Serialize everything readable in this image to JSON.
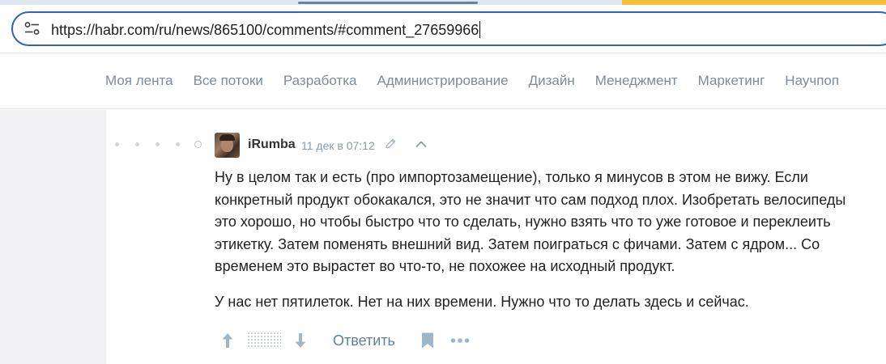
{
  "browser": {
    "url": "https://habr.com/ru/news/865100/comments/#comment_27659966",
    "colors": {
      "accent": "#2e65b8",
      "tab_highlight": "#f5bf3a"
    }
  },
  "nav": {
    "items": [
      "Моя лента",
      "Все потоки",
      "Разработка",
      "Администрирование",
      "Дизайн",
      "Менеджмент",
      "Маркетинг",
      "Научпоп"
    ]
  },
  "comment": {
    "author": "iRumba",
    "timestamp": "11 дек в 07:12",
    "paragraphs": [
      "Ну в целом так и есть (про импортозамещение), только я минусов в этом не вижу. Если конкретный продукт обокакался, это не значит что сам подход плох. Изобретать велосипеды это хорошо, но чтобы быстро что то сделать, нужно взять что то уже готовое и переклеить этикетку. Затем поменять внешний вид. Затем поиграться с фичами. Затем с ядром... Со временем это вырастет во что-то, не похожее на исходный продукт.",
      "У нас нет пятилеток. Нет на них времени. Нужно что то делать здесь и сейчас."
    ],
    "reply_label": "Ответить",
    "icons": [
      "edit-icon",
      "collapse-icon",
      "vote-up-icon",
      "vote-down-icon",
      "bookmark-icon",
      "more-icon"
    ]
  }
}
